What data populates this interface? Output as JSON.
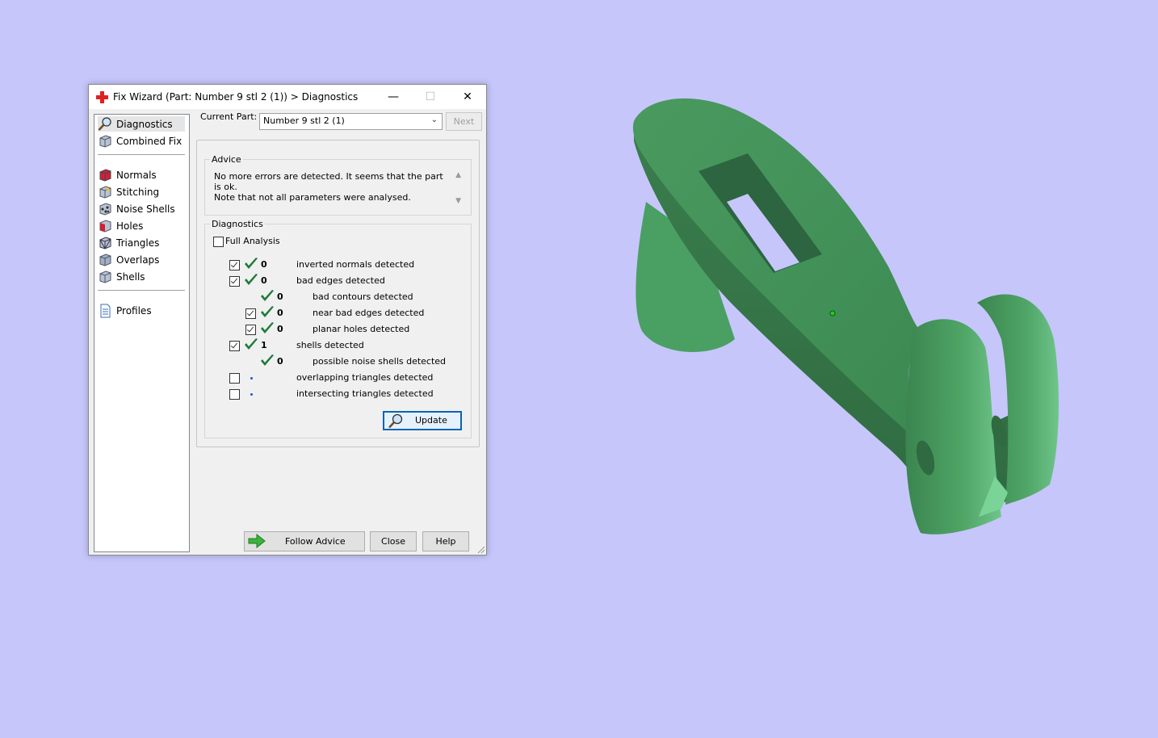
{
  "window": {
    "title": "Fix Wizard (Part: Number 9 stl 2 (1)) > Diagnostics",
    "minimize_glyph": "—",
    "maximize_glyph": "☐",
    "close_glyph": "✕"
  },
  "sidebar": {
    "items": [
      {
        "label": "Diagnostics",
        "icon": "magnifier-icon",
        "selected": true
      },
      {
        "label": "Combined Fix",
        "icon": "cube-icon"
      },
      {
        "label": "Normals",
        "icon": "normals-cube-icon"
      },
      {
        "label": "Stitching",
        "icon": "stitching-cube-icon"
      },
      {
        "label": "Noise Shells",
        "icon": "noise-shells-icon"
      },
      {
        "label": "Holes",
        "icon": "holes-cube-icon"
      },
      {
        "label": "Triangles",
        "icon": "triangles-cube-icon"
      },
      {
        "label": "Overlaps",
        "icon": "overlaps-cube-icon"
      },
      {
        "label": "Shells",
        "icon": "shells-cube-icon"
      },
      {
        "label": "Profiles",
        "icon": "document-icon"
      }
    ]
  },
  "current_part": {
    "label": "Current Part:",
    "value": "Number 9 stl 2 (1)",
    "next_label": "Next"
  },
  "advice": {
    "title": "Advice",
    "text": "No more errors are detected. It seems that the part is ok.\nNote that not all parameters were analysed."
  },
  "diagnostics": {
    "title": "Diagnostics",
    "full_analysis_label": "Full Analysis",
    "full_analysis_checked": false,
    "rows": [
      {
        "checkbox": true,
        "checked": true,
        "status": "ok",
        "count": "0",
        "label": "inverted normals detected",
        "indent": 0
      },
      {
        "checkbox": true,
        "checked": true,
        "status": "ok",
        "count": "0",
        "label": "bad edges detected",
        "indent": 0
      },
      {
        "checkbox": false,
        "checked": false,
        "status": "ok",
        "count": "0",
        "label": "bad contours detected",
        "indent": 1
      },
      {
        "checkbox": true,
        "checked": true,
        "status": "ok",
        "count": "0",
        "label": "near bad edges detected",
        "indent": 1
      },
      {
        "checkbox": true,
        "checked": true,
        "status": "ok",
        "count": "0",
        "label": "planar holes detected",
        "indent": 1
      },
      {
        "checkbox": true,
        "checked": true,
        "status": "ok",
        "count": "1",
        "label": "shells detected",
        "indent": 0
      },
      {
        "checkbox": false,
        "checked": false,
        "status": "ok",
        "count": "0",
        "label": "possible noise shells detected",
        "indent": 1
      },
      {
        "checkbox": true,
        "checked": false,
        "status": "pending",
        "count": "",
        "label": "overlapping triangles detected",
        "indent": 0
      },
      {
        "checkbox": true,
        "checked": false,
        "status": "pending",
        "count": "",
        "label": "intersecting triangles detected",
        "indent": 0
      }
    ],
    "update_label": "Update"
  },
  "footer": {
    "follow_advice_label": "Follow Advice",
    "close_label": "Close",
    "help_label": "Help"
  },
  "colors": {
    "background": "#c6c6fb",
    "model_green": "#3f8f55",
    "tick_green": "#1f7a3a",
    "accent_blue": "#0a64b4"
  }
}
